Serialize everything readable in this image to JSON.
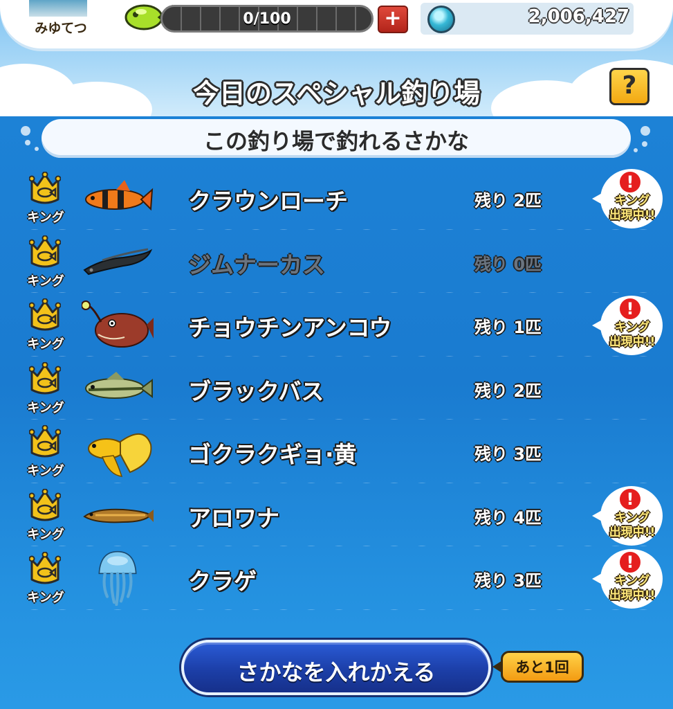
{
  "status_bar": {
    "player_name": "みゆてつ",
    "stamina_text": "0/100",
    "stamina_fraction": 0.0,
    "plus_label": "+",
    "gem_count": "2,006,427"
  },
  "screen": {
    "title": "今日のスペシャル釣り場",
    "help_label": "?"
  },
  "section": {
    "header": "この釣り場で釣れるさかな"
  },
  "fish": [
    {
      "name": "クラウンローチ",
      "remaining": "残り 2匹",
      "king_label": "キング",
      "alert_mark": "!",
      "alert_text": "キング出現中!!",
      "alert": true,
      "depleted": false,
      "icon": "clown-loach"
    },
    {
      "name": "ジムナーカス",
      "remaining": "残り 0匹",
      "king_label": "キング",
      "alert_mark": "",
      "alert_text": "",
      "alert": false,
      "depleted": true,
      "icon": "gymnarchus"
    },
    {
      "name": "チョウチンアンコウ",
      "remaining": "残り 1匹",
      "king_label": "キング",
      "alert_mark": "!",
      "alert_text": "キング出現中!!",
      "alert": true,
      "depleted": false,
      "icon": "anglerfish"
    },
    {
      "name": "ブラックバス",
      "remaining": "残り 2匹",
      "king_label": "キング",
      "alert_mark": "",
      "alert_text": "",
      "alert": false,
      "depleted": false,
      "icon": "black-bass"
    },
    {
      "name": "ゴクラクギョ·黄",
      "remaining": "残り 3匹",
      "king_label": "キング",
      "alert_mark": "",
      "alert_text": "",
      "alert": false,
      "depleted": false,
      "icon": "yellow-paradise-fish"
    },
    {
      "name": "アロワナ",
      "remaining": "残り 4匹",
      "king_label": "キング",
      "alert_mark": "!",
      "alert_text": "キング出現中!!",
      "alert": true,
      "depleted": false,
      "icon": "arowana"
    },
    {
      "name": "クラゲ",
      "remaining": "残り 3匹",
      "king_label": "キング",
      "alert_mark": "!",
      "alert_text": "キング出現中!!",
      "alert": true,
      "depleted": false,
      "icon": "jellyfish"
    }
  ],
  "footer": {
    "swap_button": "さかなを入れかえる",
    "remaining_tag": "あと1回"
  },
  "colors": {
    "panel_blue": "#1a7bd0",
    "crown_gold": "#f2c21a",
    "alert_red": "#e51e1e",
    "button_blue": "#1c3fa8",
    "tag_orange": "#f39b12"
  }
}
